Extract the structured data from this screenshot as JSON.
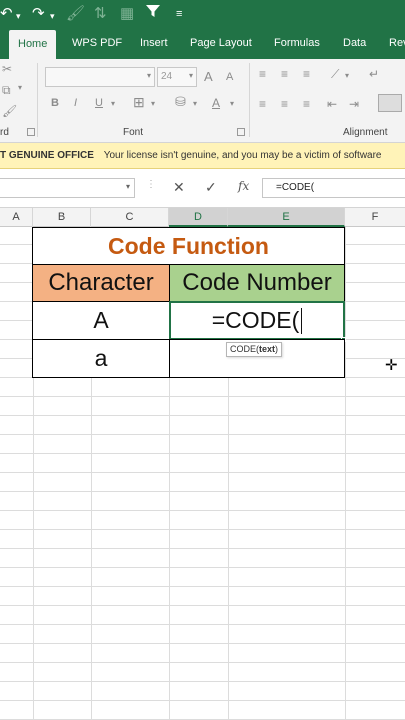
{
  "qat": {
    "undo_icon": "undo-icon",
    "redo_icon": "redo-icon",
    "format_painter_icon": "format-painter-icon",
    "sort_icon": "sort-icon",
    "chart_icon": "chart-icon",
    "filter_icon": "filter-icon",
    "customize_icon": "customize-icon"
  },
  "tabs": [
    "Home",
    "WPS PDF",
    "Insert",
    "Page Layout",
    "Formulas",
    "Data",
    "Rev"
  ],
  "ribbon": {
    "font_size": "24",
    "clipboard_label": "rd",
    "font_label": "Font",
    "alignment_label": "Alignment",
    "bold": "B",
    "italic": "I",
    "underline": "U",
    "grow_font": "A",
    "shrink_font": "A",
    "font_color": "A"
  },
  "warning": {
    "title": "T GENUINE OFFICE",
    "message": "Your license isn't genuine, and you may be a victim of software"
  },
  "formula_bar": {
    "name_box": "",
    "cancel": "✕",
    "enter": "✓",
    "fx": "fx",
    "formula": "=CODE("
  },
  "columns": [
    "A",
    "B",
    "C",
    "D",
    "E",
    "F"
  ],
  "table": {
    "title": "Code Function",
    "header_character": "Character",
    "header_code": "Code Number",
    "rows": [
      {
        "character": "A",
        "code": "=CODE("
      },
      {
        "character": "a",
        "code": ""
      }
    ]
  },
  "tooltip": {
    "fn": "CODE(",
    "arg": "text",
    "close": ")"
  },
  "colors": {
    "accent": "#217346",
    "title_orange": "#c55a11",
    "header_character": "#f4b183",
    "header_code": "#a9d18e",
    "warning_bg": "#fff3b8"
  }
}
